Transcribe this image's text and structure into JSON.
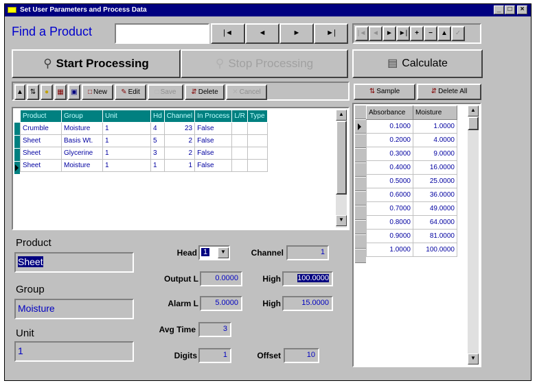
{
  "window": {
    "title": "Set User Parameters and Process Data"
  },
  "titlebar_buttons": [
    "_",
    "□",
    "×"
  ],
  "find": {
    "label": "Find a Product",
    "value": ""
  },
  "nav": {
    "first": "|◄",
    "prev": "◄",
    "next": "►",
    "last": "►|"
  },
  "process": {
    "start_label": "Start Processing",
    "stop_label": "Stop Processing",
    "calculate_label": "Calculate"
  },
  "toolbar": {
    "new_label": "New",
    "edit_label": "Edit",
    "save_label": "Save",
    "delete_label": "Delete",
    "cancel_label": "Cancel"
  },
  "grid": {
    "columns": [
      "Product",
      "Group",
      "Unit",
      "Hd",
      "Channel",
      "In Process",
      "L/R",
      "Type"
    ],
    "rows": [
      [
        "Crumble",
        "Moisture",
        "1",
        "4",
        "23",
        "False",
        "",
        ""
      ],
      [
        "Sheet",
        "Basis Wt.",
        "1",
        "5",
        "2",
        "False",
        "",
        ""
      ],
      [
        "Sheet",
        "Glycerine",
        "1",
        "3",
        "2",
        "False",
        "",
        ""
      ],
      [
        "Sheet",
        "Moisture",
        "1",
        "1",
        "1",
        "False",
        "",
        ""
      ]
    ],
    "current_row": 3
  },
  "detail": {
    "product_label": "Product",
    "product_value": "Sheet",
    "group_label": "Group",
    "group_value": "Moisture",
    "unit_label": "Unit",
    "unit_value": "1",
    "head_label": "Head",
    "head_value": "1",
    "channel_label": "Channel",
    "channel_value": "1",
    "output_label": "Output L",
    "output_low": "0.0000",
    "output_high_label": "High",
    "output_high": "100.0000",
    "alarm_label": "Alarm L",
    "alarm_low": "5.0000",
    "alarm_high_label": "High",
    "alarm_high": "15.0000",
    "avg_label": "Avg Time",
    "avg_value": "3",
    "digits_label": "Digits",
    "digits_value": "1",
    "offset_label": "Offset",
    "offset_value": "10"
  },
  "right": {
    "sample_label": "Sample",
    "delete_all_label": "Delete All",
    "columns": [
      "Absorbance",
      "Moisture"
    ],
    "rows": [
      [
        "0.1000",
        "1.0000"
      ],
      [
        "0.2000",
        "4.0000"
      ],
      [
        "0.3000",
        "9.0000"
      ],
      [
        "0.4000",
        "16.0000"
      ],
      [
        "0.5000",
        "25.0000"
      ],
      [
        "0.6000",
        "36.0000"
      ],
      [
        "0.7000",
        "49.0000"
      ],
      [
        "0.8000",
        "64.0000"
      ],
      [
        "0.9000",
        "81.0000"
      ],
      [
        "1.0000",
        "100.0000"
      ]
    ]
  },
  "colors": {
    "titlebar": "#000080",
    "grid_header": "#008080",
    "face": "#c0c0c0",
    "text_blue": "#0000c0"
  }
}
